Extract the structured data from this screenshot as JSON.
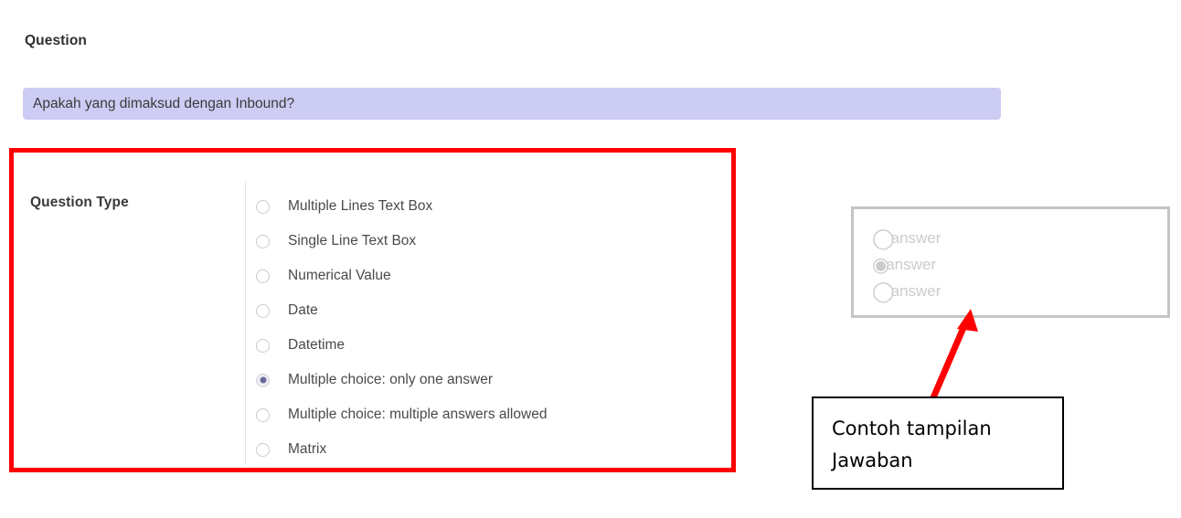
{
  "question_section": {
    "heading": "Question",
    "input_value": "Apakah yang dimaksud dengan Inbound?",
    "input_placeholder": "Question",
    "input_background": "#ccccf4"
  },
  "question_type_section": {
    "label": "Question Type",
    "highlight_color": "#ff0000",
    "selected_option": "Multiple choice: only one answer",
    "options": [
      {
        "label": "Multiple Lines Text Box",
        "selected": false
      },
      {
        "label": "Single Line Text Box",
        "selected": false
      },
      {
        "label": "Numerical Value",
        "selected": false
      },
      {
        "label": "Date",
        "selected": false
      },
      {
        "label": "Datetime",
        "selected": false
      },
      {
        "label": "Multiple choice: only one answer",
        "selected": true
      },
      {
        "label": "Multiple choice: multiple answers allowed",
        "selected": false
      },
      {
        "label": "Matrix",
        "selected": false
      }
    ]
  },
  "answer_preview": {
    "border_color": "#c4c4c4",
    "text_color": "#cbcbcb",
    "items": [
      {
        "glyph": "◯",
        "label": "answer",
        "selected": false
      },
      {
        "glyph": "◉",
        "label": "answer",
        "selected": true
      },
      {
        "glyph": "◯",
        "label": "answer",
        "selected": false
      }
    ]
  },
  "annotation": {
    "text": "Contoh tampilan\nJawaban",
    "arrow_color": "#ff0000",
    "border_color": "#000000"
  }
}
